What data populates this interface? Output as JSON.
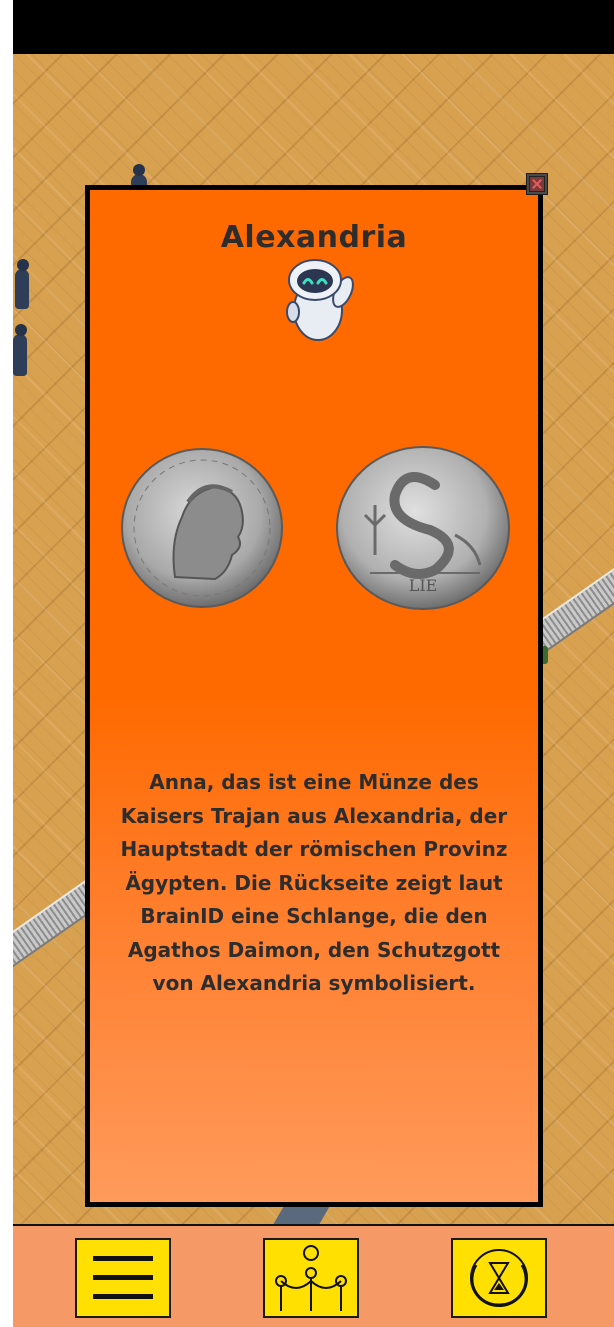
{
  "dialog": {
    "title": "Alexandria",
    "text": "Anna, das ist eine Münze des Kaisers Trajan aus Alexandria, der Hauptstadt der römischen Provinz Ägypten. Die Rückseite zeigt laut BrainID eine Schlange, die den Agathos Daimon, den Schutzgott von Alexandria symbolisiert.",
    "coin_back_inscription": "LIE"
  },
  "icons": {
    "close": "close-icon",
    "mascot": "robot-mascot",
    "menu": "hamburger-menu-icon",
    "exhibit": "museum-rope-barrier-icon",
    "timer": "hourglass-compass-icon"
  },
  "colors": {
    "dialog_top": "#ff6a00",
    "dialog_bottom": "#ff9a5b",
    "button": "#ffe000",
    "bottom_bar": "#f59a66",
    "floor": "#d8a150",
    "text": "#2d2d2d"
  }
}
